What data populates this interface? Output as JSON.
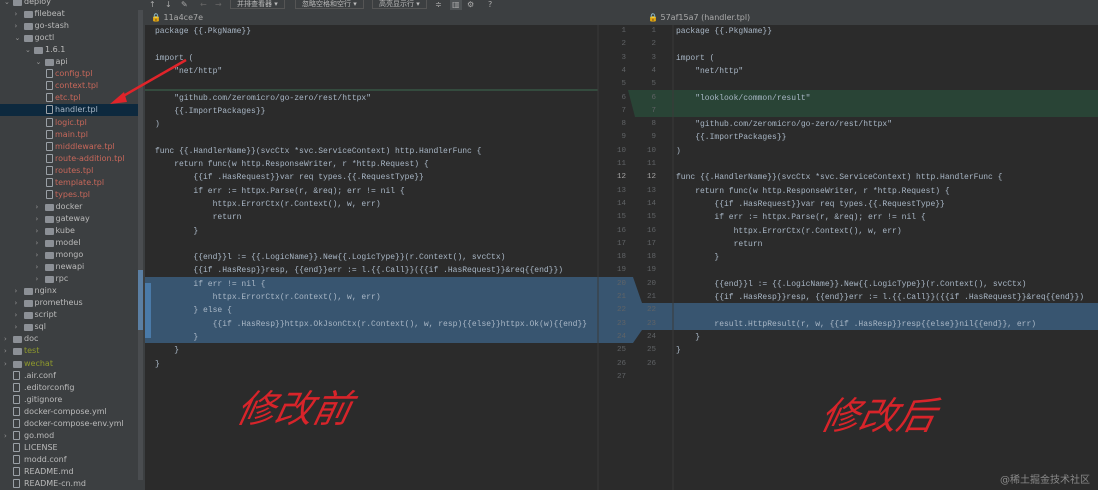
{
  "sidebar": {
    "items": [
      {
        "label": "deploy",
        "lvl": 0,
        "type": "folder",
        "open": true,
        "color": "#bbbbbb"
      },
      {
        "label": "filebeat",
        "lvl": 1,
        "type": "folder",
        "open": false,
        "color": "#bbbbbb"
      },
      {
        "label": "go-stash",
        "lvl": 1,
        "type": "folder",
        "open": false,
        "color": "#bbbbbb"
      },
      {
        "label": "goctl",
        "lvl": 1,
        "type": "folder",
        "open": true,
        "color": "#bbbbbb"
      },
      {
        "label": "1.6.1",
        "lvl": 2,
        "type": "folder",
        "open": true,
        "color": "#bbbbbb"
      },
      {
        "label": "api",
        "lvl": 3,
        "type": "folder",
        "open": true,
        "color": "#bbbbbb"
      },
      {
        "label": "config.tpl",
        "lvl": 4,
        "type": "file",
        "color": "#c7675a"
      },
      {
        "label": "context.tpl",
        "lvl": 4,
        "type": "file",
        "color": "#c7675a"
      },
      {
        "label": "etc.tpl",
        "lvl": 4,
        "type": "file",
        "color": "#c7675a"
      },
      {
        "label": "handler.tpl",
        "lvl": 4,
        "type": "file",
        "color": "#a9b7c6",
        "selected": true
      },
      {
        "label": "logic.tpl",
        "lvl": 4,
        "type": "file",
        "color": "#c7675a"
      },
      {
        "label": "main.tpl",
        "lvl": 4,
        "type": "file",
        "color": "#c7675a"
      },
      {
        "label": "middleware.tpl",
        "lvl": 4,
        "type": "file",
        "color": "#c7675a"
      },
      {
        "label": "route-addition.tpl",
        "lvl": 4,
        "type": "file",
        "color": "#c7675a"
      },
      {
        "label": "routes.tpl",
        "lvl": 4,
        "type": "file",
        "color": "#c7675a"
      },
      {
        "label": "template.tpl",
        "lvl": 4,
        "type": "file",
        "color": "#c7675a"
      },
      {
        "label": "types.tpl",
        "lvl": 4,
        "type": "file",
        "color": "#c7675a"
      },
      {
        "label": "docker",
        "lvl": 3,
        "type": "folder",
        "open": false,
        "color": "#bbbbbb"
      },
      {
        "label": "gateway",
        "lvl": 3,
        "type": "folder",
        "open": false,
        "color": "#bbbbbb"
      },
      {
        "label": "kube",
        "lvl": 3,
        "type": "folder",
        "open": false,
        "color": "#bbbbbb"
      },
      {
        "label": "model",
        "lvl": 3,
        "type": "folder",
        "open": false,
        "color": "#bbbbbb"
      },
      {
        "label": "mongo",
        "lvl": 3,
        "type": "folder",
        "open": false,
        "color": "#bbbbbb"
      },
      {
        "label": "newapi",
        "lvl": 3,
        "type": "folder",
        "open": false,
        "color": "#bbbbbb"
      },
      {
        "label": "rpc",
        "lvl": 3,
        "type": "folder",
        "open": false,
        "color": "#bbbbbb"
      },
      {
        "label": "nginx",
        "lvl": 1,
        "type": "folder",
        "open": false,
        "color": "#bbbbbb"
      },
      {
        "label": "prometheus",
        "lvl": 1,
        "type": "folder",
        "open": false,
        "color": "#bbbbbb"
      },
      {
        "label": "script",
        "lvl": 1,
        "type": "folder",
        "open": false,
        "color": "#bbbbbb"
      },
      {
        "label": "sql",
        "lvl": 1,
        "type": "folder",
        "open": false,
        "color": "#bbbbbb"
      },
      {
        "label": "doc",
        "lvl": 0,
        "type": "folder",
        "open": false,
        "color": "#bbbbbb"
      },
      {
        "label": "test",
        "lvl": 0,
        "type": "folder",
        "open": false,
        "color": "#8f9a2c"
      },
      {
        "label": "wechat",
        "lvl": 0,
        "type": "folder",
        "open": false,
        "color": "#8f9a2c"
      },
      {
        "label": ".air.conf",
        "lvl": 0,
        "type": "file",
        "color": "#bbbbbb"
      },
      {
        "label": ".editorconfig",
        "lvl": 0,
        "type": "file",
        "color": "#bbbbbb"
      },
      {
        "label": ".gitignore",
        "lvl": 0,
        "type": "file",
        "color": "#bbbbbb"
      },
      {
        "label": "docker-compose.yml",
        "lvl": 0,
        "type": "file",
        "color": "#bbbbbb"
      },
      {
        "label": "docker-compose-env.yml",
        "lvl": 0,
        "type": "file",
        "color": "#bbbbbb"
      },
      {
        "label": "go.mod",
        "lvl": 0,
        "type": "file",
        "color": "#bbbbbb",
        "arrow": true
      },
      {
        "label": "LICENSE",
        "lvl": 0,
        "type": "file",
        "color": "#bbbbbb"
      },
      {
        "label": "modd.conf",
        "lvl": 0,
        "type": "file",
        "color": "#bbbbbb"
      },
      {
        "label": "README.md",
        "lvl": 0,
        "type": "file",
        "color": "#bbbbbb"
      },
      {
        "label": "README-cn.md",
        "lvl": 0,
        "type": "file",
        "color": "#bbbbbb"
      }
    ]
  },
  "toolbar": {
    "up_icon": "↑",
    "down_icon": "↓",
    "edit_icon": "✎",
    "back_icon": "←",
    "forward_icon": "→",
    "viewer_dropdown": "并排查看器 ▾",
    "whitespace_dropdown": "忽略空格和空行 ▾",
    "highlight_dropdown": "高亮显示行 ▾",
    "collapse_icon": "≑",
    "columns_icon": "▥",
    "settings_icon": "⚙",
    "help_icon": "?"
  },
  "left_pane": {
    "header": "🔒 11a4ce7e",
    "lines": [
      "package {{.PkgName}}",
      "",
      "import (",
      "    \"net/http\"",
      "",
      "    \"github.com/zeromicro/go-zero/rest/httpx\"",
      "    {{.ImportPackages}}",
      ")",
      "",
      "func {{.HandlerName}}(svcCtx *svc.ServiceContext) http.HandlerFunc {",
      "    return func(w http.ResponseWriter, r *http.Request) {",
      "        {{if .HasRequest}}var req types.{{.RequestType}}",
      "        if err := httpx.Parse(r, &req); err != nil {",
      "            httpx.ErrorCtx(r.Context(), w, err)",
      "            return",
      "        }",
      "",
      "        {{end}}l := {{.LogicName}}.New{{.LogicType}}(r.Context(), svcCtx)",
      "        {{if .HasResp}}resp, {{end}}err := l.{{.Call}}({{if .HasRequest}}&req{{end}})",
      "        if err != nil {",
      "            httpx.ErrorCtx(r.Context(), w, err)",
      "        } else {",
      "            {{if .HasResp}}httpx.OkJsonCtx(r.Context(), w, resp){{else}}httpx.Ok(w){{end}}",
      "        }",
      "    }",
      "}"
    ],
    "annotation": "修改前"
  },
  "right_pane": {
    "header": "🔒 57af15a7 (handler.tpl)",
    "left_numbers": [
      "1",
      "2",
      "3",
      "4",
      "5",
      "6",
      "7",
      "8",
      "9",
      "10",
      "11",
      "12",
      "13",
      "14",
      "15",
      "16",
      "17",
      "18",
      "19",
      "20",
      "21",
      "22",
      "23",
      "24",
      "25",
      "26",
      "27"
    ],
    "right_numbers": [
      "1",
      "2",
      "3",
      "4",
      "5",
      "6",
      "7",
      "8",
      "9",
      "10",
      "11",
      "12",
      "13",
      "14",
      "15",
      "16",
      "17",
      "18",
      "19",
      "20",
      "21",
      "22",
      "23",
      "24",
      "25",
      "26"
    ],
    "lines": [
      "package {{.PkgName}}",
      "",
      "import (",
      "    \"net/http\"",
      "",
      "    \"looklook/common/result\"",
      "",
      "    \"github.com/zeromicro/go-zero/rest/httpx\"",
      "    {{.ImportPackages}}",
      ")",
      "",
      "func {{.HandlerName}}(svcCtx *svc.ServiceContext) http.HandlerFunc {",
      "    return func(w http.ResponseWriter, r *http.Request) {",
      "        {{if .HasRequest}}var req types.{{.RequestType}}",
      "        if err := httpx.Parse(r, &req); err != nil {",
      "            httpx.ErrorCtx(r.Context(), w, err)",
      "            return",
      "        }",
      "",
      "        {{end}}l := {{.LogicName}}.New{{.LogicType}}(r.Context(), svcCtx)",
      "        {{if .HasResp}}resp, {{end}}err := l.{{.Call}}({{if .HasRequest}}&req{{end}})",
      "",
      "        result.HttpResult(r, w, {{if .HasResp}}resp{{else}}nil{{end}}, err)",
      "    }",
      "}",
      ""
    ],
    "annotation": "修改后"
  },
  "watermark": "@稀土掘金技术社区",
  "colors": {
    "added": "#294436",
    "changed": "#385570",
    "arrow": "#e0242a"
  }
}
